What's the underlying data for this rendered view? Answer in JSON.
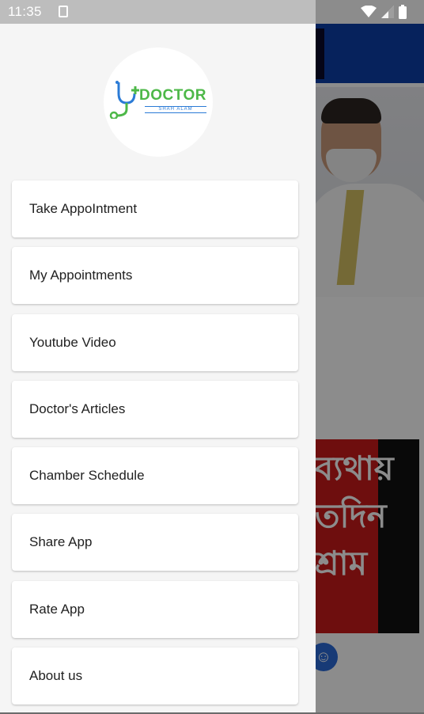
{
  "status_bar": {
    "time": "11:35"
  },
  "logo": {
    "word": "DOCTOR",
    "sub": "SHAH ALAM"
  },
  "drawer": {
    "items": [
      {
        "label": "Take AppoIntment"
      },
      {
        "label": "My Appointments"
      },
      {
        "label": "Youtube Video"
      },
      {
        "label": "Doctor's Articles"
      },
      {
        "label": "Chamber Schedule"
      },
      {
        "label": "Share App"
      },
      {
        "label": "Rate App"
      },
      {
        "label": "About us"
      }
    ]
  },
  "background": {
    "banner_text": "ব্যথায়\nতদিন\nশ্রাম"
  },
  "colors": {
    "appbar": "#0b3fa8",
    "logo_green": "#4db848",
    "logo_blue": "#2b7bd6",
    "banner_red": "#c81a1a"
  }
}
